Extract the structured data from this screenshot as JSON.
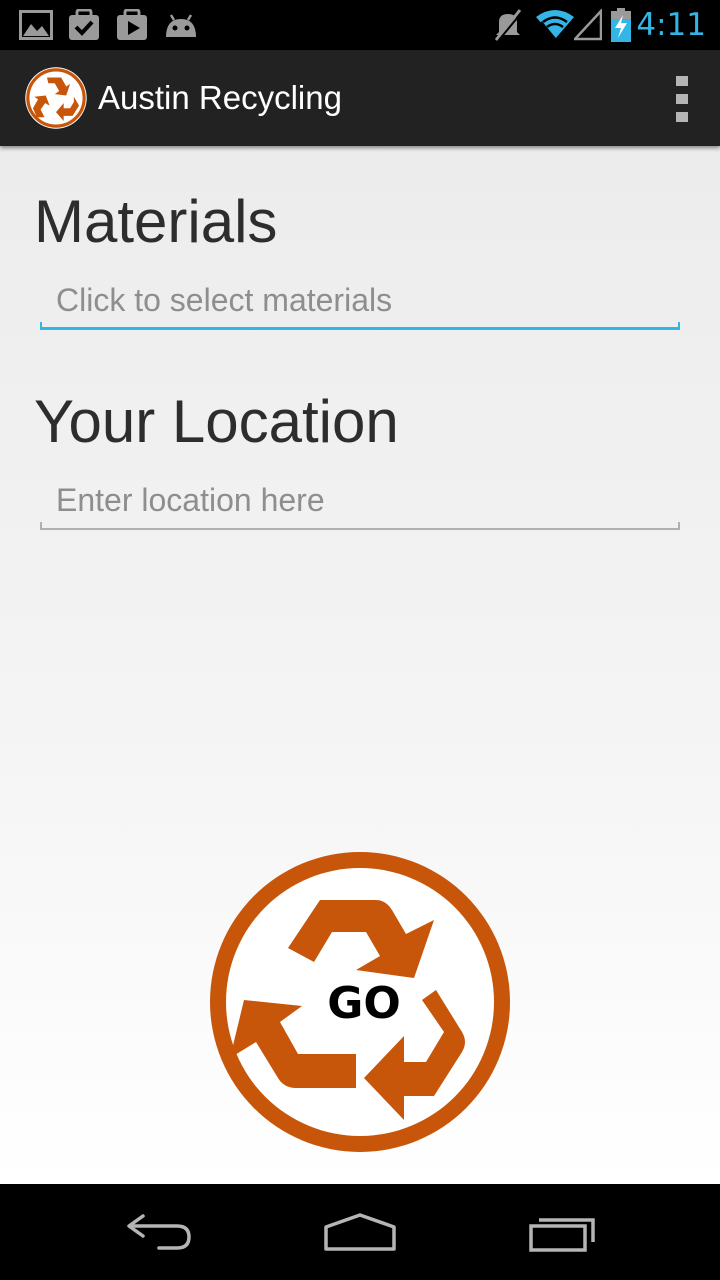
{
  "status_bar": {
    "time": "4:11",
    "icons": [
      "gallery-icon",
      "task-check-icon",
      "play-store-icon",
      "android-icon",
      "mute-icon",
      "wifi-icon",
      "signal-icon",
      "battery-charging-icon"
    ],
    "time_color": "#33b5e5"
  },
  "action_bar": {
    "title": "Austin Recycling",
    "logo_icon": "recycle-icon",
    "menu_icon": "overflow-menu-icon"
  },
  "form": {
    "materials": {
      "heading": "Materials",
      "placeholder": "Click to select materials",
      "value": ""
    },
    "location": {
      "heading": "Your Location",
      "placeholder": "Enter location here",
      "value": ""
    }
  },
  "go_button": {
    "label": "GO",
    "icon": "recycle-icon"
  },
  "nav_bar": {
    "icons": [
      "back-icon",
      "home-icon",
      "recent-apps-icon"
    ]
  },
  "colors": {
    "brand_orange": "#c8560a",
    "accent_blue": "#33b5e5",
    "action_bar": "#222222"
  }
}
